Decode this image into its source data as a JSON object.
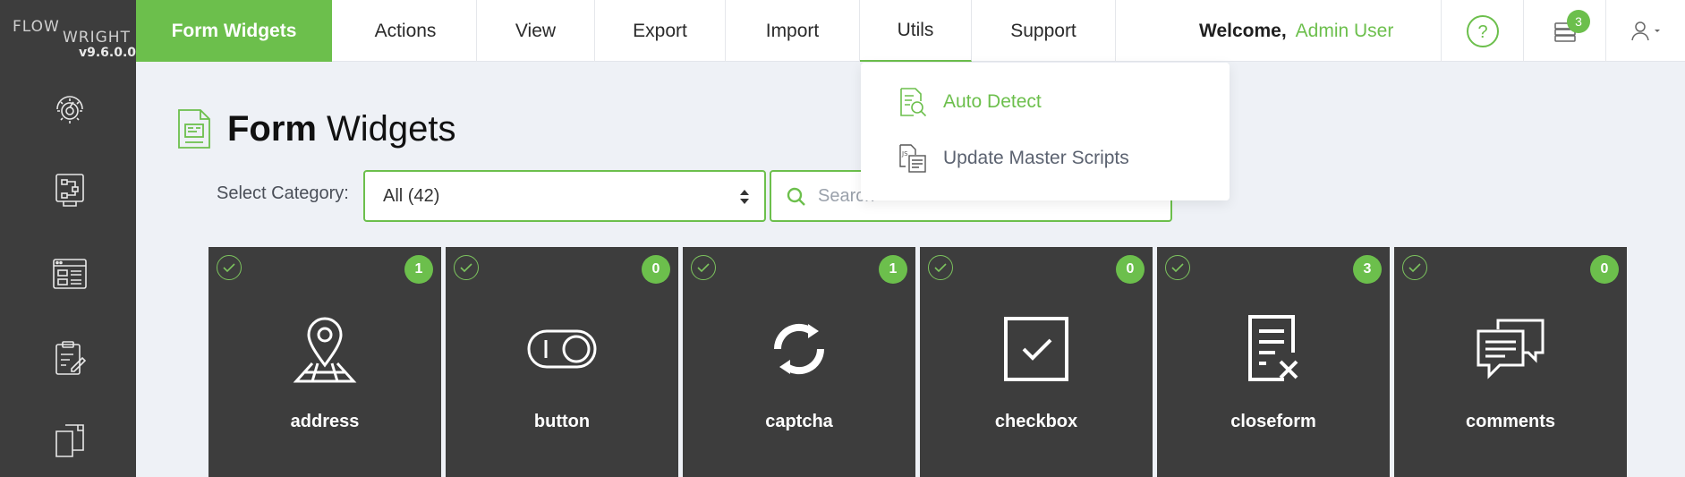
{
  "app": {
    "logo_line1": "FLOW",
    "logo_line2": "WRIGHT",
    "version": "v9.6.0.0"
  },
  "sidebar": {
    "icons": [
      "dashboard-gear-icon",
      "workflow-icon",
      "form-layout-icon",
      "clipboard-edit-icon",
      "document-copy-icon"
    ]
  },
  "nav": {
    "items": [
      {
        "label": "Form Widgets"
      },
      {
        "label": "Actions"
      },
      {
        "label": "View"
      },
      {
        "label": "Export"
      },
      {
        "label": "Import"
      },
      {
        "label": "Utils"
      },
      {
        "label": "Support"
      }
    ],
    "welcome_label": "Welcome,",
    "user_name": "Admin User",
    "notification_count": "3"
  },
  "page": {
    "title_bold": "Form",
    "title_rest": "Widgets"
  },
  "filter": {
    "category_label": "Select Category:",
    "category_value": "All (42)",
    "search_placeholder": "Search"
  },
  "widgets": [
    {
      "name": "address",
      "count": "1",
      "icon": "map-pin-icon"
    },
    {
      "name": "button",
      "count": "0",
      "icon": "toggle-button-icon"
    },
    {
      "name": "captcha",
      "count": "1",
      "icon": "refresh-arrows-icon"
    },
    {
      "name": "checkbox",
      "count": "0",
      "icon": "checkbox-icon"
    },
    {
      "name": "closeform",
      "count": "3",
      "icon": "document-close-icon"
    },
    {
      "name": "comments",
      "count": "0",
      "icon": "chat-bubbles-icon"
    }
  ],
  "utils_menu": {
    "items": [
      {
        "label": "Auto Detect",
        "icon": "auto-detect-icon"
      },
      {
        "label": "Update Master Scripts",
        "icon": "script-update-icon"
      }
    ]
  },
  "colors": {
    "accent": "#6cbf4c",
    "sidebar": "#3d3d3d",
    "card": "#3d3d3d"
  }
}
